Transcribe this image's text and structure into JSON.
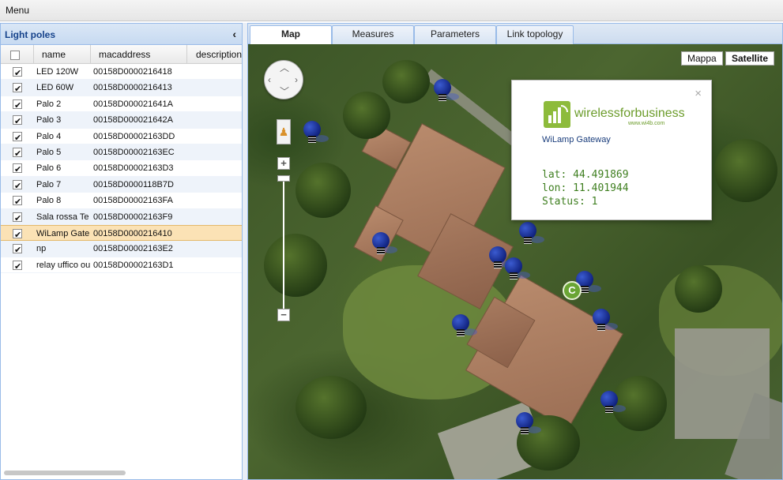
{
  "menubar": {
    "menu_label": "Menu"
  },
  "left_panel": {
    "title": "Light poles",
    "collapse_icon": "chevron-left-icon",
    "columns": {
      "name": "name",
      "macaddress": "macaddress",
      "description": "description"
    },
    "rows": [
      {
        "name": "LED 120W",
        "mac": "00158D0000216418",
        "checked": true
      },
      {
        "name": "LED 60W",
        "mac": "00158D0000216413",
        "checked": true
      },
      {
        "name": "Palo 2",
        "mac": "00158D000021641A",
        "checked": true
      },
      {
        "name": "Palo 3",
        "mac": "00158D000021642A",
        "checked": true
      },
      {
        "name": "Palo 4",
        "mac": "00158D00002163DD",
        "checked": true
      },
      {
        "name": "Palo 5",
        "mac": "00158D00002163EC",
        "checked": true
      },
      {
        "name": "Palo 6",
        "mac": "00158D00002163D3",
        "checked": true
      },
      {
        "name": "Palo 7",
        "mac": "00158D0000118B7D",
        "checked": true
      },
      {
        "name": "Palo 8",
        "mac": "00158D00002163FA",
        "checked": true
      },
      {
        "name": "Sala rossa Te",
        "mac": "00158D00002163F9",
        "checked": true
      },
      {
        "name": "WiLamp Gate",
        "mac": "00158D0000216410",
        "checked": true,
        "selected": true
      },
      {
        "name": "np",
        "mac": "00158D00002163E2",
        "checked": true
      },
      {
        "name": "relay uffico ou",
        "mac": "00158D00002163D1",
        "checked": true
      }
    ]
  },
  "tabs": [
    {
      "label": "Map",
      "active": true
    },
    {
      "label": "Measures"
    },
    {
      "label": "Parameters"
    },
    {
      "label": "Link topology"
    }
  ],
  "map": {
    "map_types": {
      "map": "Mappa",
      "satellite": "Satellite"
    },
    "zoom_in": "+",
    "zoom_out": "−",
    "gateway_marker": "C",
    "info_window": {
      "logo_text": "wirelessforbusiness",
      "logo_url": "www.wi4b.com",
      "subtitle": "WiLamp Gateway",
      "lat": "lat: 44.491869",
      "lon": "lon: 11.401944",
      "status": "Status: 1",
      "close": "×"
    }
  },
  "colors": {
    "panel_border": "#99bbe8",
    "selected_row": "#fbe2b5",
    "marker_green": "#6aa534",
    "bulb_blue": "#1a2f9e"
  }
}
